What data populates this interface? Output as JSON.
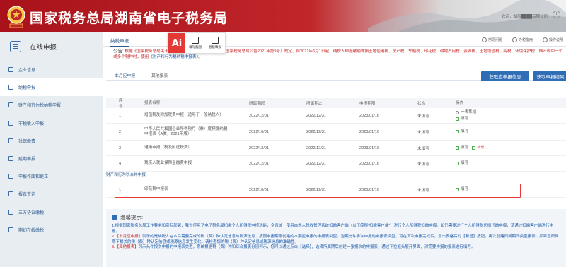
{
  "header": {
    "site_title": "国家税务总局湖南省电子税务局",
    "user_info": "欢迎，湖南████有限公司"
  },
  "sidebar": {
    "heading": "在线申报",
    "items": [
      {
        "label": "企业信息",
        "active": false
      },
      {
        "label": "纳税申报",
        "active": true
      },
      {
        "label": "财产和行为税纳税申报",
        "active": false
      },
      {
        "label": "非税收入申报",
        "active": false
      },
      {
        "label": "社保缴费",
        "active": false
      },
      {
        "label": "延期申报",
        "active": false
      },
      {
        "label": "申报作废和更正",
        "active": false
      },
      {
        "label": "报表查询",
        "active": false
      },
      {
        "label": "三方协议缴税",
        "active": false
      },
      {
        "label": "期初在线缴税",
        "active": false
      }
    ]
  },
  "topbar": {
    "active_tab": "纳税申报",
    "links": [
      "常见问题",
      "办税指南",
      "操作说明"
    ]
  },
  "float_tools": {
    "ai": "Ai",
    "screenshot": "幕写截图",
    "assistant": "智能填报"
  },
  "notice": {
    "label": "公告:",
    "text": "根据《国家税务总局关于简并税费申报有关事项的公告》（国家税务总局公告2021年第9号）规定，自2021年6月1日起，纳税人申报缴纳城镇土地使用税、房产税、车船税、印花税、耕地占用税、资源税、土地增值税、契税、环境保护税、烟叶税中一个或多个税种时，使用",
    "link": "《财产和行为税纳税申报表》",
    "tail": "。"
  },
  "subtabs": {
    "tab1": "本月应申报",
    "tab2": "其他报表"
  },
  "buttons": {
    "get_info": "获取应申报信息",
    "get_result": "获取申报结果"
  },
  "table": {
    "headers": [
      "序号",
      "报表名称",
      "所属期起",
      "所属期止",
      "申报期限",
      "状态",
      "操作"
    ],
    "rows": [
      {
        "no": "1",
        "name": "增值税及附加税费申报（适用于一般纳税人）",
        "start": "2022/12/01",
        "end": "2022/12/31",
        "deadline": "2023/01/16",
        "status": "未填写",
        "actions": [
          "一表集成",
          "填写"
        ]
      },
      {
        "no": "2",
        "name": "中华人民共和国企业所得税月（季）度预缴纳税申报表（A类，2021年版）",
        "start": "2022/10/01",
        "end": "2022/12/31",
        "deadline": "2023/01/16",
        "status": "未填写",
        "actions": [
          "填写"
        ]
      },
      {
        "no": "3",
        "name": "通用申报（税及附征税费）",
        "start": "2022/12/01",
        "end": "2022/12/31",
        "deadline": "2023/01/16",
        "status": "未填写",
        "actions": [
          "填写",
          "新增"
        ]
      },
      {
        "no": "4",
        "name": "残疾人就业保障金缴费申报",
        "start": "2022/12/01",
        "end": "2022/12/31",
        "deadline": "2023/01/16",
        "status": "未填写",
        "actions": [
          "填写"
        ]
      }
    ],
    "group_title": "财产和行为税合并申报",
    "group_rows": [
      {
        "no": "1",
        "name": "印花税申报表",
        "start": "2022/10/01",
        "end": "2022/12/31",
        "deadline": "2023/01/16",
        "status": "未填写",
        "actions": [
          "填写"
        ]
      }
    ]
  },
  "tips": {
    "title": "温馨提示:",
    "lines": [
      {
        "prefix": "",
        "text": "1.根据国家税务总局工作要求和实际部署，我省停用了电子税务局扣缴个人所得税申报功能，全省统一使用自然人税收管理系统扣缴客户端（以下简称“扣缴客户端”）进行个人所得税扣缴申报。如仍需要进行个人所得税代扣代缴申报，请通过扣缴客户端进行申报。"
      },
      {
        "prefix": "2.【本月应申报】",
        "text": "列示的是纳税人在本月需要完成的税（费）种认定信息与税源信息、按照申报期限创建的本期应申报的申报表类型。当期允许多次申报的申报表类型，可在首次申报完成后，点击表格后的【新增】按钮，再次创建同属期同类型报表。如果您所属期下相关的税（费）种认定信息或税源信息发生变化，请检查您的税（费）种认定信息或税源信息的准确性。"
      },
      {
        "prefix": "3.【其他报表】",
        "text": "列示允许按次申报的申报表类型。系统根据税（费）种和综合报表分别列示，您可以通过点击【选择】，选择所属期后创建一张报次的申报表，通过下拉框头展开界面，对需要申报的报表进行填写。"
      }
    ]
  }
}
